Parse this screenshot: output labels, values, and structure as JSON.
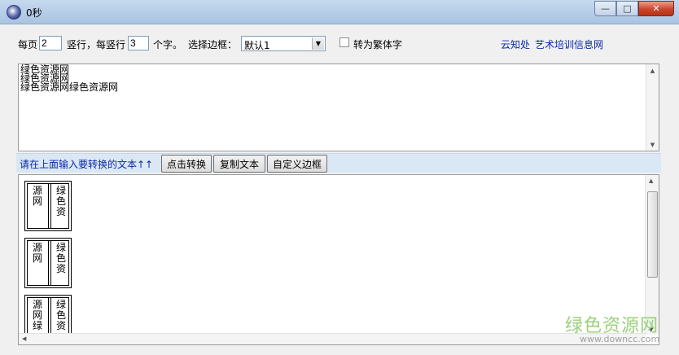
{
  "window": {
    "title": "0秒",
    "minimize_glyph": "—",
    "maximize_glyph": "□",
    "close_glyph": "✕"
  },
  "options": {
    "per_page_label": "每页",
    "per_page_value": "2",
    "rows_label": "竖行，每竖行",
    "per_row_value": "3",
    "chars_label": "个字。",
    "border_label": "选择边框：",
    "border_selected": "默认1",
    "traditional_label": "转为繁体字",
    "traditional_checked": false,
    "link1": "云知处",
    "link2": "艺术培训信息网"
  },
  "input": {
    "lines": [
      "绿色资源网",
      "绿色资源网",
      "绿色资源网绿色资源网"
    ]
  },
  "toolbar": {
    "hint": "请在上面输入要转换的文本↑↑",
    "convert_label": "点击转换",
    "copy_label": "复制文本",
    "custom_border_label": "自定义边框"
  },
  "output": {
    "pages": [
      {
        "left_col": [
          "源",
          "网"
        ],
        "right_col": [
          "绿",
          "色",
          "资"
        ]
      },
      {
        "left_col": [
          "源",
          "网"
        ],
        "right_col": [
          "绿",
          "色",
          "资"
        ]
      },
      {
        "left_col": [
          "源",
          "网",
          "绿"
        ],
        "right_col": [
          "绿",
          "色",
          "资"
        ]
      }
    ]
  },
  "watermark": {
    "main": "绿色资源网",
    "sub": "www.downcc.com"
  }
}
